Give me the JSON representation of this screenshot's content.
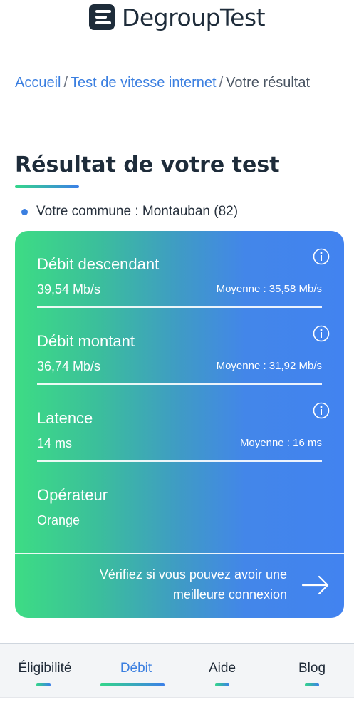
{
  "header": {
    "logo_text": "DegroupTest",
    "logo_icon": "degrouptest-logo-icon"
  },
  "breadcrumb": {
    "home": "Accueil",
    "section": "Test de vitesse internet",
    "current": "Votre résultat",
    "separator": "/"
  },
  "page": {
    "title": "Résultat de votre test",
    "commune": "Votre commune : Montauban (82)"
  },
  "metrics": {
    "download": {
      "label": "Débit descendant",
      "value": "39,54 Mb/s",
      "average": "Moyenne : 35,58 Mb/s"
    },
    "upload": {
      "label": "Débit montant",
      "value": "36,74 Mb/s",
      "average": "Moyenne : 31,92 Mb/s"
    },
    "latency": {
      "label": "Latence",
      "value": "14 ms",
      "average": "Moyenne : 16 ms"
    },
    "operator": {
      "label": "Opérateur",
      "value": "Orange"
    }
  },
  "cta": {
    "line1": "Vérifiez si vous pouvez avoir une",
    "line2": "meilleure connexion"
  },
  "nav": {
    "items": [
      {
        "label": "Éligibilité"
      },
      {
        "label": "Débit"
      },
      {
        "label": "Aide"
      },
      {
        "label": "Blog"
      }
    ],
    "active": "Débit"
  },
  "colors": {
    "accent_blue": "#3b7fe0",
    "accent_green": "#3ddc84",
    "card_blue": "#4283f0"
  }
}
